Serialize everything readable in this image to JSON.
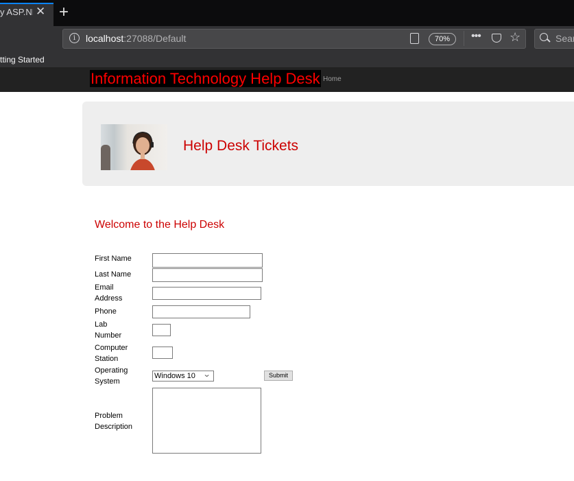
{
  "browser": {
    "tab_title": "y ASP.NE",
    "url_host": "localhost",
    "url_rest": ":27088/Default",
    "zoom": "70%",
    "search_placeholder": "Sear",
    "bookmark": "tting Started",
    "more_glyph": "•••",
    "star_glyph": "☆",
    "close_glyph": "✕",
    "newtab_glyph": "+",
    "info_glyph": "i"
  },
  "site": {
    "brand": "Information Technology Help Desk",
    "nav_home": "Home"
  },
  "hero": {
    "title": "Help Desk Tickets"
  },
  "form": {
    "welcome": "Welcome to the Help Desk",
    "labels": {
      "first_name": "First Name",
      "last_name": "Last Name",
      "email_1": "Email",
      "email_2": "Address",
      "phone": "Phone",
      "lab_1": "Lab",
      "lab_2": "Number",
      "station_1": "Computer",
      "station_2": "Station",
      "os_1": "Operating",
      "os_2": "System",
      "problem_1": "Problem",
      "problem_2": "Description"
    },
    "values": {
      "first_name": "",
      "last_name": "",
      "email": "",
      "phone": "",
      "lab": "",
      "station": "",
      "problem": ""
    },
    "os_selected": "Windows 10",
    "submit": "Submit"
  }
}
